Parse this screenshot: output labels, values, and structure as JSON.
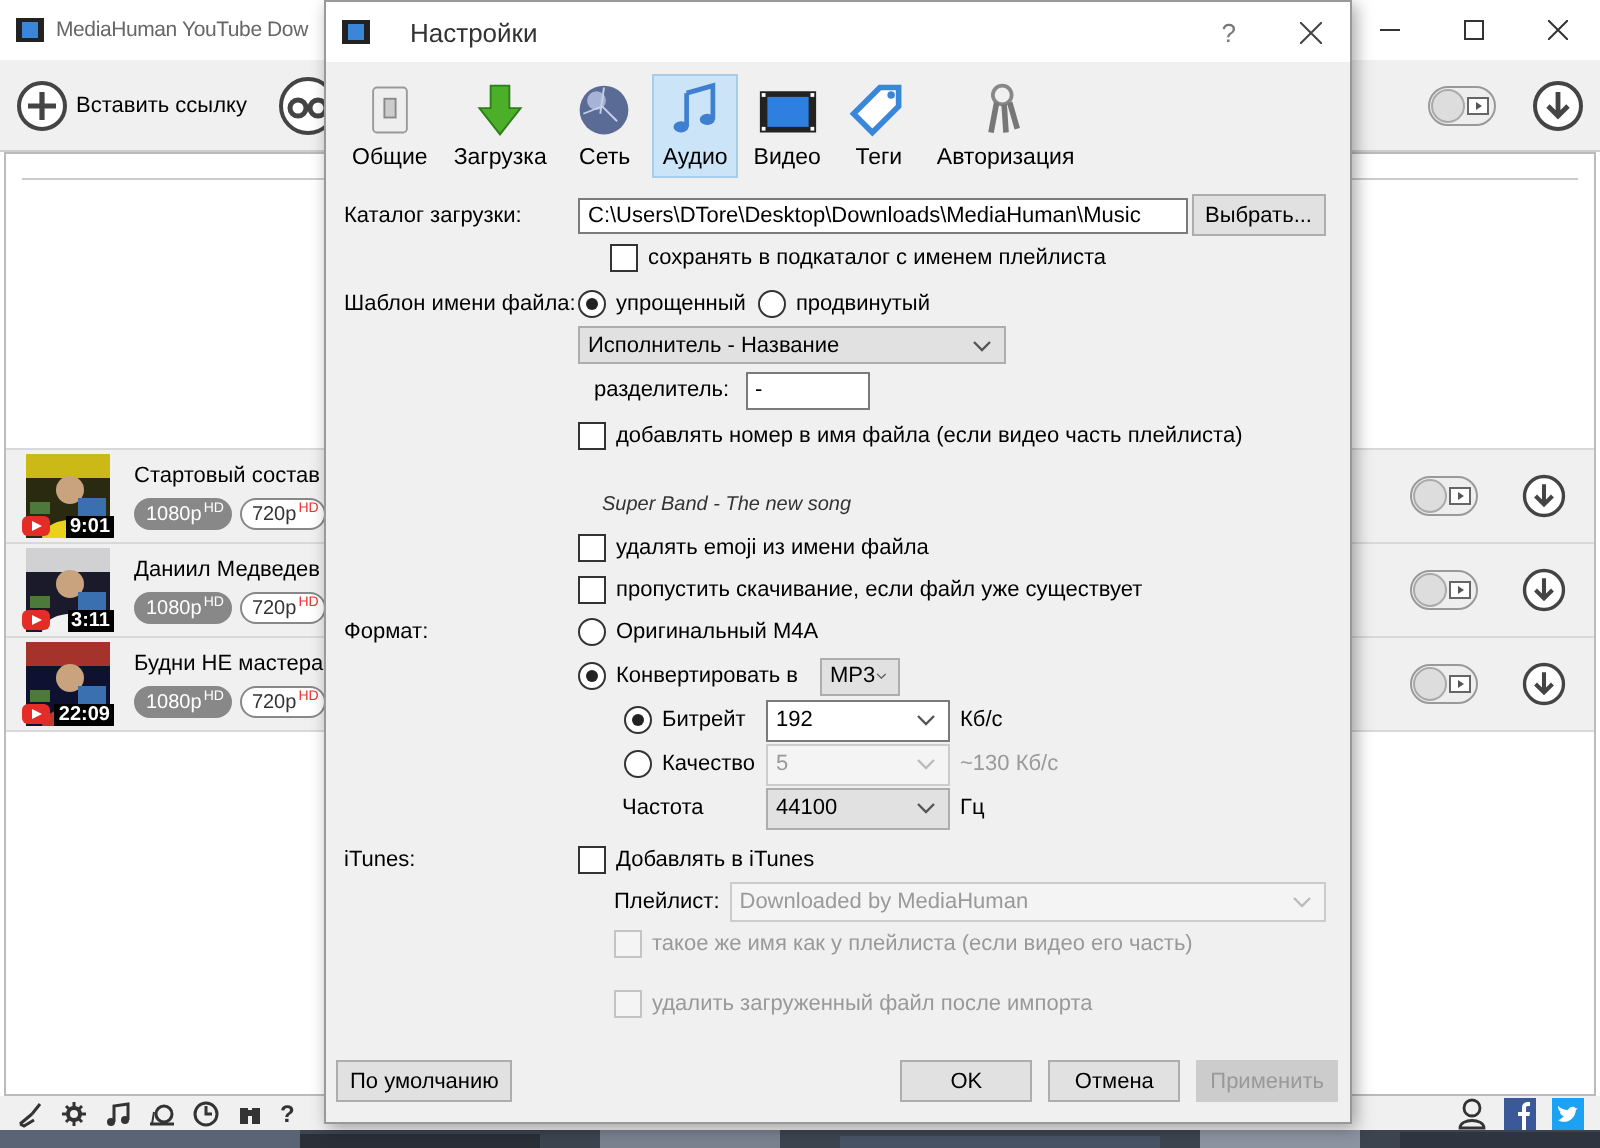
{
  "main_window": {
    "title": "MediaHuman YouTube Dow",
    "paste_button": "Вставить ссылку",
    "mode_toggle": {
      "on": false
    },
    "downloads": [
      {
        "title": "Стартовый состав",
        "duration": "9:01",
        "toggle_on": false,
        "qualities": [
          {
            "label": "1080p",
            "badge": "HD",
            "selected": true
          },
          {
            "label": "720p",
            "badge": "HD",
            "selected": false
          }
        ]
      },
      {
        "title": "Даниил Медведев",
        "duration": "3:11",
        "toggle_on": false,
        "qualities": [
          {
            "label": "1080p",
            "badge": "HD",
            "selected": true
          },
          {
            "label": "720p",
            "badge": "HD",
            "selected": false
          }
        ]
      },
      {
        "title": "Будни НЕ мастера",
        "duration": "22:09",
        "toggle_on": false,
        "qualities": [
          {
            "label": "1080p",
            "badge": "HD",
            "selected": true
          },
          {
            "label": "720p",
            "badge": "HD",
            "selected": false
          }
        ]
      }
    ],
    "status_bar": {
      "help": "?"
    }
  },
  "dialog": {
    "title": "Настройки",
    "help": "?",
    "tabs": [
      {
        "label": "Общие",
        "selected": false
      },
      {
        "label": "Загрузка",
        "selected": false
      },
      {
        "label": "Сеть",
        "selected": false
      },
      {
        "label": "Аудио",
        "selected": true
      },
      {
        "label": "Видео",
        "selected": false
      },
      {
        "label": "Теги",
        "selected": false
      },
      {
        "label": "Авторизация",
        "selected": false
      }
    ],
    "download_folder": {
      "label": "Каталог загрузки:",
      "value": "C:\\Users\\DTore\\Desktop\\Downloads\\MediaHuman\\Music",
      "browse_button": "Выбрать...",
      "subfolder": {
        "label": "сохранять в подкаталог с именем плейлиста",
        "checked": false
      }
    },
    "filename_template": {
      "label": "Шаблон имени файла:",
      "modes": [
        {
          "label": "упрощенный",
          "selected": true
        },
        {
          "label": "продвинутый",
          "selected": false
        }
      ],
      "pattern": "Исполнитель - Название",
      "separator_label": "разделитель:",
      "separator": "-",
      "number_option": {
        "label": "добавлять номер в имя файла (если видео часть плейлиста)",
        "checked": false
      },
      "example": "Super Band - The new song",
      "options": [
        {
          "label": "удалять emoji из имени файла",
          "checked": false
        },
        {
          "label": "пропустить скачивание, если файл уже существует",
          "checked": false
        }
      ]
    },
    "format": {
      "label": "Формат:",
      "choices": [
        {
          "label": "Оригинальный M4A",
          "selected": false
        },
        {
          "label": "Конвертировать в",
          "selected": true
        }
      ],
      "codec": "MP3",
      "quality_modes": [
        {
          "label": "Битрейт",
          "selected": true,
          "value": "192",
          "unit": "Кб/с",
          "disabled": false
        },
        {
          "label": "Качество",
          "selected": false,
          "value": "5",
          "unit": "~130 Кб/с",
          "disabled": true
        }
      ],
      "frequency": {
        "label": "Частота",
        "value": "44100",
        "unit": "Гц"
      }
    },
    "itunes": {
      "label": "iTunes:",
      "add": {
        "label": "Добавлять в iTunes",
        "checked": false
      },
      "playlist_label": "Плейлист:",
      "playlist": "Downloaded by MediaHuman",
      "disabled": true,
      "options": [
        {
          "label": "такое же имя как у плейлиста (если видео его часть)",
          "checked": false
        },
        {
          "label": "удалить загруженный файл после импорта",
          "checked": false
        }
      ]
    },
    "buttons": {
      "defaults": "По умолчанию",
      "ok": "OK",
      "cancel": "Отмена",
      "apply": {
        "label": "Применить",
        "disabled": true
      }
    }
  }
}
